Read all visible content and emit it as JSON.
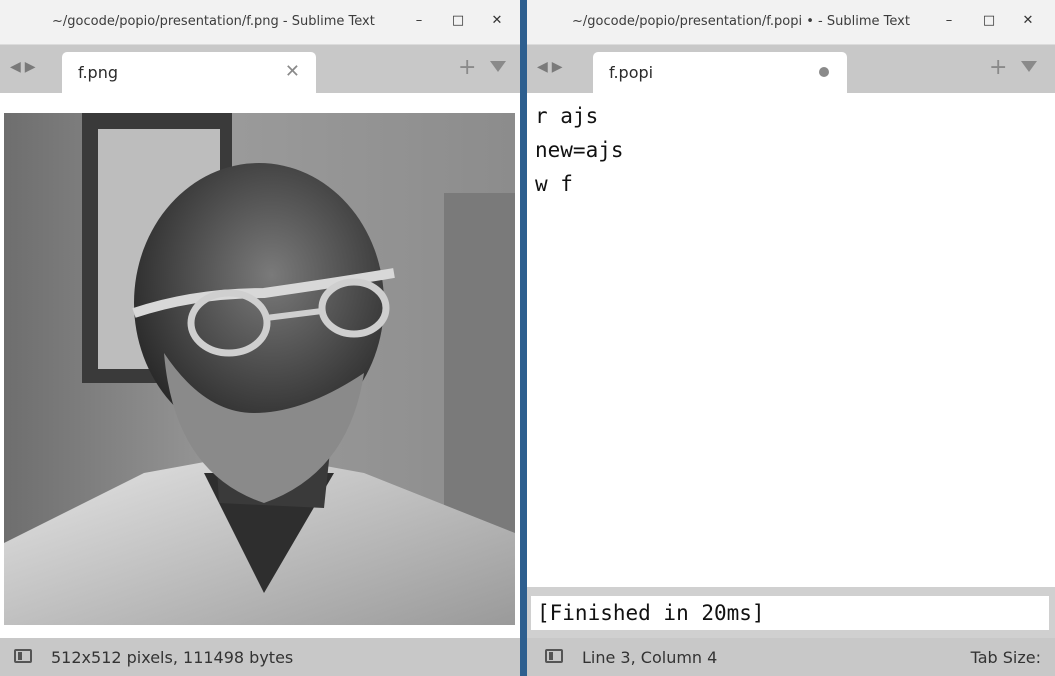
{
  "left_window": {
    "title": "~/gocode/popio/presentation/f.png - Sublime Text",
    "tab": {
      "label": "f.png"
    },
    "image": {
      "description": ""
    },
    "status": {
      "text": "512x512 pixels, 111498 bytes"
    }
  },
  "right_window": {
    "title": "~/gocode/popio/presentation/f.popi • - Sublime Text",
    "tab": {
      "label": "f.popi",
      "modified": true
    },
    "code_lines": [
      "r ajs",
      "new=ajs",
      "w f"
    ],
    "output": "[Finished in 20ms]",
    "status": {
      "position": "Line 3, Column 4",
      "tab_size": "Tab Size:"
    }
  },
  "window_controls": {
    "minimize": "–",
    "maximize": "□",
    "close": "✕"
  },
  "tabbar": {
    "nav_back": "◀",
    "nav_forward": "▶",
    "new_tab": "+",
    "close_tab": "✕"
  },
  "colors": {
    "window_border": "#2e5f8f",
    "tabbar_bg": "#c8c8c8",
    "titlebar_bg": "#f2f2f2"
  }
}
